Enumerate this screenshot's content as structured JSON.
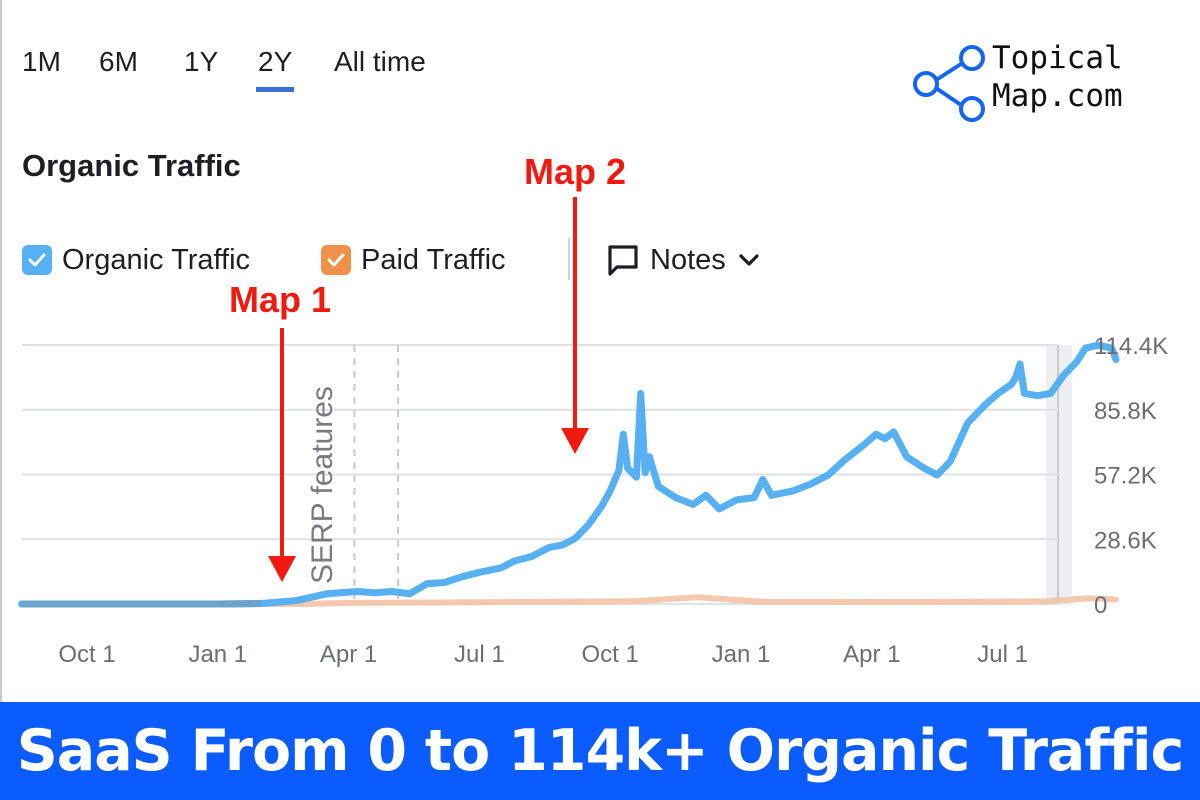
{
  "periods": [
    {
      "label": "1M",
      "active": false
    },
    {
      "label": "6M",
      "active": false
    },
    {
      "label": "1Y",
      "active": false
    },
    {
      "label": "2Y",
      "active": true
    },
    {
      "label": "All time",
      "active": false
    }
  ],
  "section_title": "Organic Traffic",
  "legend": {
    "organic_label": "Organic Traffic",
    "paid_label": "Paid Traffic",
    "notes_label": "Notes"
  },
  "logo": {
    "line1": "Topical",
    "line2": "Map.com"
  },
  "banner": {
    "text": "SaaS From 0 to 114k+ Organic Traffic"
  },
  "colors": {
    "organic": "#56b0f2",
    "paid": "#f4c3a6",
    "paid_checkbox": "#ef9148",
    "active_tab": "#3a6fd8",
    "annotation": "#f01a10",
    "banner": "#0a5cff",
    "logo_blue": "#1565f5"
  },
  "annotations": [
    {
      "label": "Map 1",
      "month_index": 5.3,
      "value": 5000
    },
    {
      "label": "Map 2",
      "month_index": 12.0,
      "value": 66000
    }
  ],
  "chart_data": {
    "type": "line",
    "title": "Organic Traffic",
    "xlabel": "",
    "ylabel": "",
    "x_unit": "months since Oct 1 (year 1); negative = before",
    "x_range": [
      -1.5,
      22.9
    ],
    "ylim": [
      0,
      114400
    ],
    "yticks": [
      0,
      28600,
      57200,
      85800,
      114400
    ],
    "ytick_labels": [
      "0",
      "28.6K",
      "57.2K",
      "85.8K",
      "114.4K"
    ],
    "xticks": [
      0,
      3,
      6,
      9,
      12,
      15,
      18,
      21
    ],
    "xtick_labels": [
      "Oct 1",
      "Jan 1",
      "Apr 1",
      "Jul 1",
      "Oct 1",
      "Jan 1",
      "Apr 1",
      "Jul 1"
    ],
    "grid": true,
    "legend": "top-left",
    "event_marker": {
      "label": "SERP features",
      "month_index": 5.3
    },
    "event_lines": [
      6.5,
      7.5
    ],
    "series": [
      {
        "name": "Organic Traffic",
        "points": [
          [
            -1.5,
            0
          ],
          [
            0,
            0
          ],
          [
            1,
            0
          ],
          [
            2,
            0
          ],
          [
            3,
            0
          ],
          [
            4,
            200
          ],
          [
            4.8,
            1500
          ],
          [
            5.5,
            4500
          ],
          [
            6.2,
            5500
          ],
          [
            6.6,
            5000
          ],
          [
            7.0,
            5500
          ],
          [
            7.4,
            4500
          ],
          [
            7.8,
            9000
          ],
          [
            8.2,
            9500
          ],
          [
            8.6,
            12000
          ],
          [
            9.0,
            14000
          ],
          [
            9.5,
            16000
          ],
          [
            9.8,
            19000
          ],
          [
            10.2,
            21000
          ],
          [
            10.6,
            25000
          ],
          [
            10.9,
            26000
          ],
          [
            11.2,
            29000
          ],
          [
            11.5,
            35000
          ],
          [
            11.8,
            43000
          ],
          [
            12.0,
            50000
          ],
          [
            12.2,
            59000
          ],
          [
            12.3,
            75000
          ],
          [
            12.4,
            60000
          ],
          [
            12.6,
            56000
          ],
          [
            12.7,
            93000
          ],
          [
            12.8,
            58000
          ],
          [
            12.9,
            65000
          ],
          [
            13.1,
            52000
          ],
          [
            13.5,
            47000
          ],
          [
            13.9,
            44000
          ],
          [
            14.2,
            48000
          ],
          [
            14.5,
            42000
          ],
          [
            14.9,
            46000
          ],
          [
            15.3,
            47000
          ],
          [
            15.5,
            55000
          ],
          [
            15.7,
            48000
          ],
          [
            16.2,
            50000
          ],
          [
            16.6,
            53000
          ],
          [
            17.0,
            57000
          ],
          [
            17.4,
            64000
          ],
          [
            17.8,
            70000
          ],
          [
            18.1,
            75000
          ],
          [
            18.3,
            73000
          ],
          [
            18.5,
            76000
          ],
          [
            18.8,
            65000
          ],
          [
            19.2,
            60000
          ],
          [
            19.5,
            57000
          ],
          [
            19.8,
            63000
          ],
          [
            20.2,
            80000
          ],
          [
            20.6,
            88000
          ],
          [
            20.9,
            93000
          ],
          [
            21.2,
            97000
          ],
          [
            21.3,
            100000
          ],
          [
            21.4,
            106000
          ],
          [
            21.5,
            93000
          ],
          [
            21.8,
            92000
          ],
          [
            22.1,
            93000
          ],
          [
            22.4,
            101000
          ],
          [
            22.7,
            107000
          ],
          [
            22.9,
            113000
          ],
          [
            23.2,
            114400
          ],
          [
            23.5,
            113000
          ],
          [
            23.6,
            108000
          ]
        ]
      },
      {
        "name": "Paid Traffic",
        "points": [
          [
            -1.5,
            0
          ],
          [
            5.0,
            0
          ],
          [
            6.0,
            500
          ],
          [
            9.0,
            800
          ],
          [
            12.5,
            1200
          ],
          [
            14.0,
            3000
          ],
          [
            15.5,
            1000
          ],
          [
            19.0,
            900
          ],
          [
            22.0,
            1200
          ],
          [
            23.0,
            2500
          ],
          [
            23.6,
            2000
          ]
        ]
      }
    ]
  }
}
